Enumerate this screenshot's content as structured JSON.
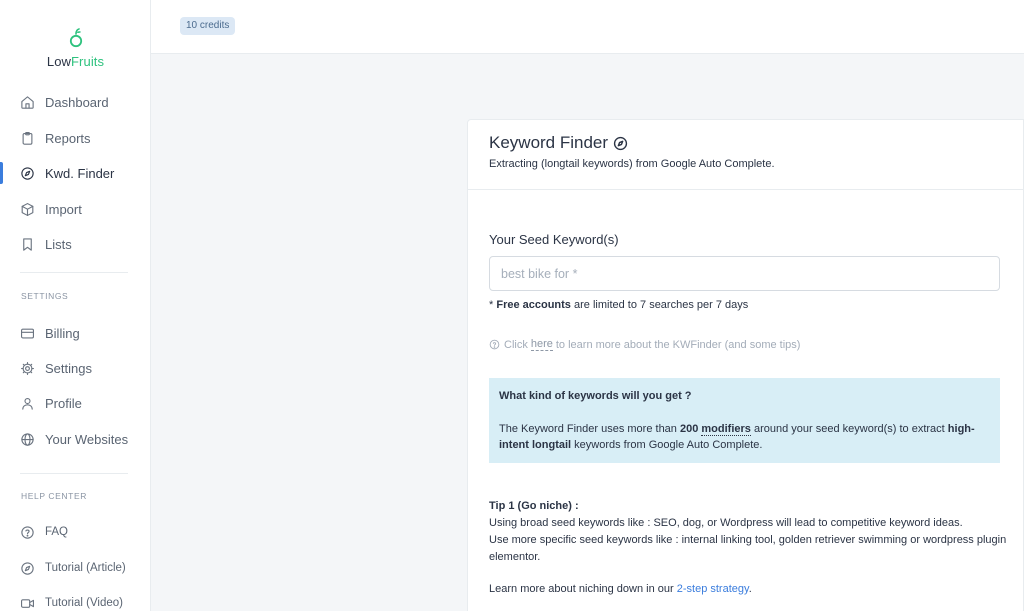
{
  "brand": {
    "name_part1": "Low",
    "name_part2": "Fruits"
  },
  "credits": "10 credits",
  "nav": {
    "main": [
      {
        "label": "Dashboard",
        "icon": "home-icon"
      },
      {
        "label": "Reports",
        "icon": "clipboard-icon"
      },
      {
        "label": "Kwd. Finder",
        "icon": "compass-icon",
        "active": true
      },
      {
        "label": "Import",
        "icon": "box-icon"
      },
      {
        "label": "Lists",
        "icon": "bookmark-icon"
      }
    ],
    "settings_title": "SETTINGS",
    "settings": [
      {
        "label": "Billing",
        "icon": "credit-card-icon"
      },
      {
        "label": "Settings",
        "icon": "gear-icon"
      },
      {
        "label": "Profile",
        "icon": "user-icon"
      },
      {
        "label": "Your Websites",
        "icon": "globe-icon"
      }
    ],
    "help_title": "HELP CENTER",
    "help": [
      {
        "label": "FAQ",
        "icon": "question-circle-icon"
      },
      {
        "label": "Tutorial (Article)",
        "icon": "compass-icon"
      },
      {
        "label": "Tutorial (Video)",
        "icon": "video-icon"
      }
    ]
  },
  "finder": {
    "title": "Keyword Finder",
    "subtitle": "Extracting (longtail keywords) from Google Auto Complete.",
    "seed_label": "Your Seed Keyword(s)",
    "seed_placeholder": "best bike for *",
    "note_prefix": "* ",
    "note_bold": "Free accounts",
    "note_rest": " are limited to 7 searches per 7 days",
    "help_prefix": "Click",
    "help_link": "here",
    "help_suffix": "to learn more about the KWFinder (and some tips)"
  },
  "info": {
    "title": "What kind of keywords will you get ?",
    "text_1": "The Keyword Finder uses more than ",
    "bold_count": "200",
    "bold_modifiers": "modifiers",
    "text_2": " around your seed keyword(s) to extract ",
    "bold_intent": "high-intent longtail",
    "text_3": " keywords from Google Auto Complete."
  },
  "tip": {
    "title": "Tip 1 (Go niche) :",
    "line_1": "Using broad seed keywords like : SEO, dog, or Wordpress will lead to competitive keyword ideas.",
    "line_2": "Use more specific seed keywords like : internal linking tool, golden retriever swimming or wordpress plugin elementor.",
    "learn_prefix": "Learn more about niching down in our ",
    "learn_link": "2-step strategy",
    "learn_suffix": "."
  }
}
